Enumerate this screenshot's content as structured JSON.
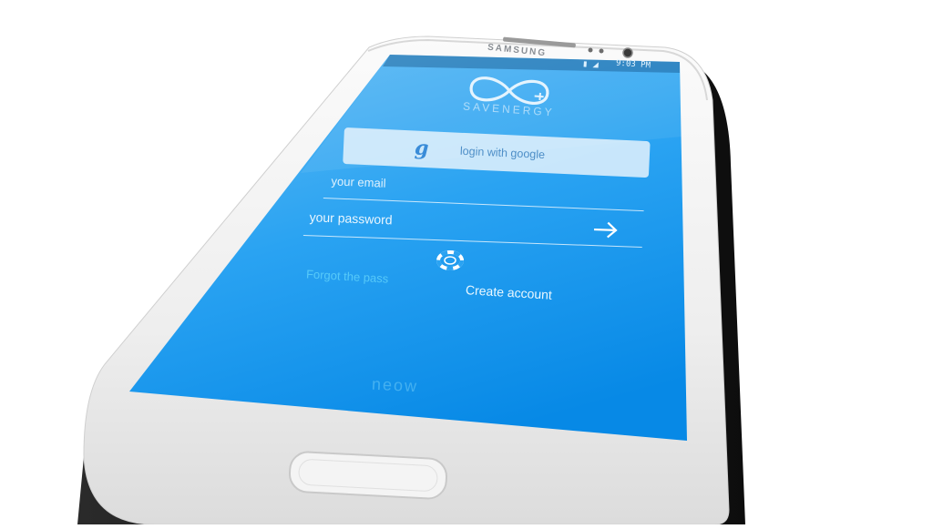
{
  "device": {
    "brand": "SAMSUNG",
    "status_bar": {
      "time": "9:03 PM",
      "icons": [
        "wifi-icon",
        "signal-icon",
        "battery-icon"
      ]
    }
  },
  "app": {
    "name": "SAVENERGY",
    "logo_icon": "infinity-plug-icon",
    "google_login": {
      "icon": "google-g-icon",
      "g_letter": "g",
      "label": "login with google"
    },
    "email_field": {
      "placeholder": "your email",
      "value": ""
    },
    "password_field": {
      "placeholder": "your password",
      "value": ""
    },
    "submit_icon": "arrow-right-icon",
    "help_icon": "lifebuoy-icon",
    "forgot_label": "Forgot the pass",
    "create_account_label": "Create account",
    "bottom_mark": "neow"
  },
  "colors": {
    "screen_top": "#4fb3f5",
    "screen_bottom": "#0a8ee8",
    "button_bg": "#e8f3fb",
    "button_text": "#4d8ec7",
    "text_light": "#eaf8ff",
    "phone_body": "#f2f2f2",
    "phone_rim": "#1a1a1a",
    "background": "#ffffff"
  }
}
